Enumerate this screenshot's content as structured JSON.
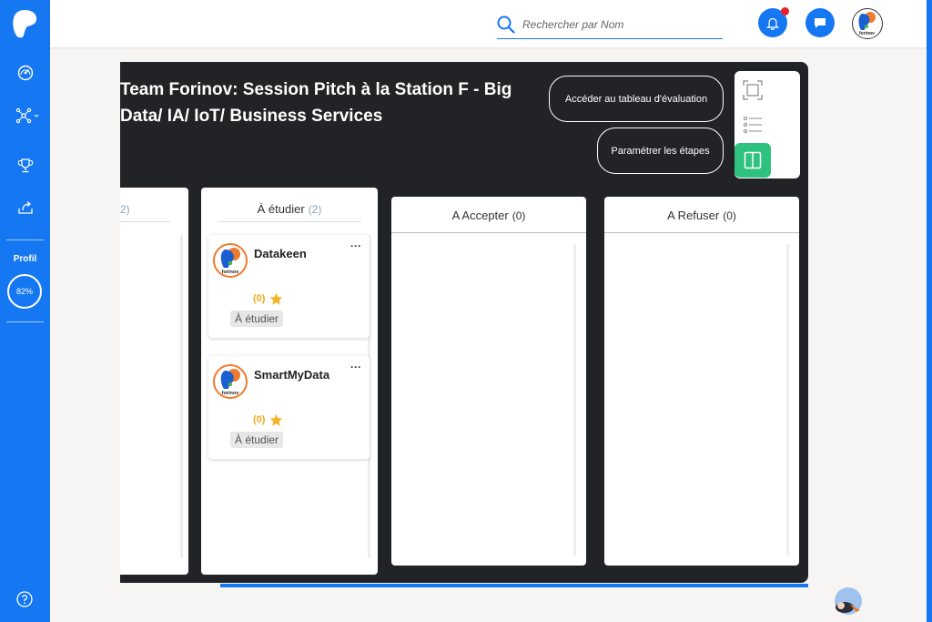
{
  "sidebar": {
    "profil_label": "Profil",
    "profil_percent": "82%",
    "items": [
      {
        "icon": "dashboard-icon"
      },
      {
        "icon": "network-icon"
      },
      {
        "icon": "trophy-icon"
      },
      {
        "icon": "share-icon"
      }
    ],
    "help_icon": "help-icon"
  },
  "header": {
    "search": {
      "placeholder": "Rechercher par Nom"
    },
    "notification_dot": true
  },
  "board": {
    "title": "Team Forinov: Session Pitch à la Station F - Big Data/ IA/ IoT/ Business Services",
    "buttons": {
      "evaluation": "Accéder au tableau d'évaluation",
      "steps": "Paramétrer les étapes"
    },
    "columns": [
      {
        "label": "",
        "count": "2)",
        "partial": true
      },
      {
        "label": "À étudier",
        "count": "(2)"
      },
      {
        "label": "A Accepter",
        "count": "(0)"
      },
      {
        "label": "A Refuser",
        "count": "(0)"
      }
    ],
    "cards": [
      {
        "name": "Datakeen",
        "rating": "(0)",
        "badge": "À étudier",
        "logo_text": "forinov"
      },
      {
        "name": "SmartMyData",
        "rating": "(0)",
        "badge": "À étudier",
        "logo_text": "forinov"
      }
    ],
    "card_menu": "···"
  },
  "avatar": {
    "logo_text": "forinov"
  },
  "colors": {
    "primary": "#1677f2",
    "board_bg": "#222326",
    "active_view": "#2ec27e",
    "rating": "#f0a81a",
    "notification": "#e4202a"
  }
}
